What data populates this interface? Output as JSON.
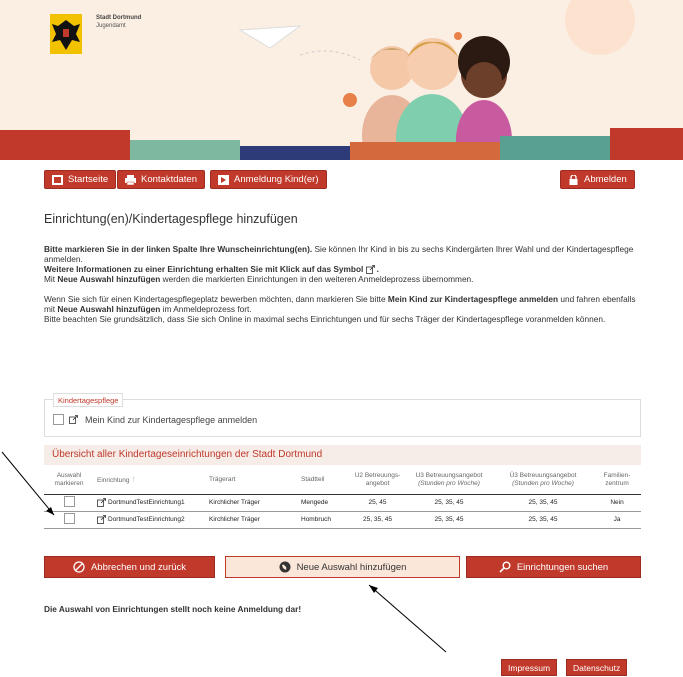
{
  "header": {
    "logo_line1": "Stadt Dortmund",
    "logo_line2": "Jugendamt"
  },
  "nav": {
    "home": "Startseite",
    "contact": "Kontaktdaten",
    "register": "Anmeldung Kind(er)",
    "logout": "Abmelden"
  },
  "page": {
    "title": "Einrichtung(en)/Kindertagespflege hinzufügen",
    "p1_bold": "Bitte markieren Sie in der linken Spalte Ihre Wunscheinrichtung(en).",
    "p1_rest": " Sie können Ihr Kind in bis zu sechs Kindergärten Ihrer Wahl und der Kindertagespflege anmelden.",
    "p2_bold": "Weitere Informationen zu einer Einrichtung erhalten Sie mit Klick auf das Symbol",
    "p3_pre": "Mit ",
    "p3_bold": "Neue Auswahl hinzufügen",
    "p3_rest": " werden die markierten Einrichtungen in den weiteren Anmeldeprozess übernommen.",
    "p4_pre": "Wenn Sie sich für einen Kindertagespflegeplatz bewerben möchten, dann markieren Sie bitte ",
    "p4_bold1": "Mein Kind zur Kindertagespflege anmelden",
    "p4_mid": " und fahren ebenfalls mit ",
    "p4_bold2": "Neue Auswahl hinzufügen",
    "p4_rest": " im Anmeldeprozess fort.",
    "p5": "Bitte beachten Sie grundsätzlich, dass Sie sich Online in maximal sechs Einrichtungen und für sechs Träger der Kindertagespflege voranmelden können."
  },
  "tagespflege": {
    "legend": "Kindertagespflege",
    "checkbox_label": "Mein Kind zur Kindertagespflege anmelden"
  },
  "table": {
    "title": "Übersicht aller Kindertageseinrichtungen der Stadt Dortmund",
    "headers": {
      "select": "Auswahl markieren",
      "facility": "Einrichtung",
      "carrier": "Trägerart",
      "district": "Stadtteil",
      "u2": "U2 Betreuungs-angebot",
      "u3_title": "U3 Betreuungsangebot",
      "u3_sub": "(Stunden pro Woche)",
      "ue3_title": "Ü3 Betreuungsangebot",
      "ue3_sub": "(Stunden pro Woche)",
      "family": "Familien-zentrum"
    },
    "rows": [
      {
        "name": "DortmundTestEinrichtung1",
        "carrier": "Kirchlicher Träger",
        "district": "Mengede",
        "u2": "25, 45",
        "u3": "25, 35, 45",
        "ue3": "25, 35, 45",
        "family": "Nein"
      },
      {
        "name": "DortmundTestEinrichtung2",
        "carrier": "Kirchlicher Träger",
        "district": "Hombruch",
        "u2": "25, 35, 45",
        "u3": "25, 35, 45",
        "ue3": "25, 35, 45",
        "family": "Ja"
      }
    ]
  },
  "actions": {
    "back": "Abbrechen und zurück",
    "add": "Neue Auswahl hinzufügen",
    "search": "Einrichtungen suchen"
  },
  "note": "Die Auswahl von Einrichtungen stellt noch keine Anmeldung dar!",
  "footer": {
    "imprint": "Impressum",
    "privacy": "Datenschutz"
  },
  "colors": {
    "accent": "#c0392b",
    "pale": "#fbe6da"
  }
}
